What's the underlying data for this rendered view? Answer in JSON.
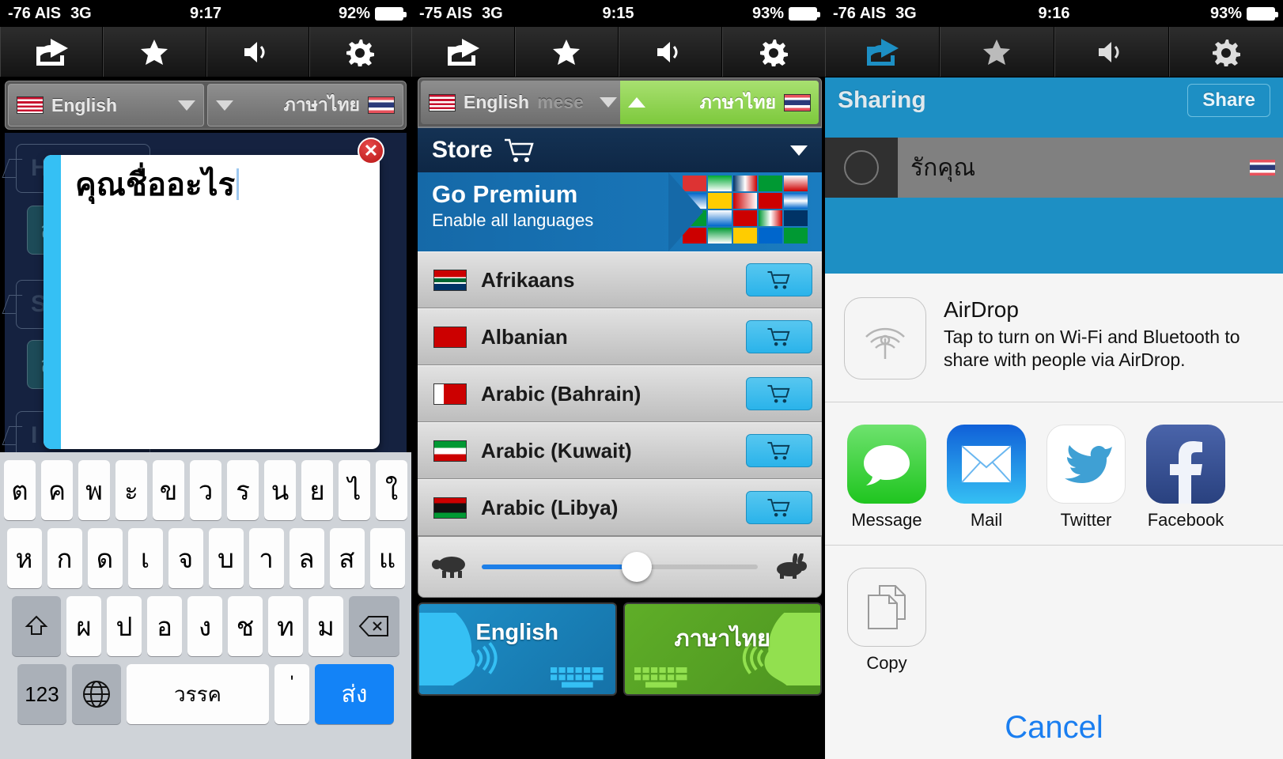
{
  "screens": [
    {
      "status": {
        "carrier": "-76 AIS",
        "network": "3G",
        "time": "9:17",
        "battery": "92%"
      },
      "toolbar": [
        "share-icon",
        "star-icon",
        "speaker-icon",
        "gear-icon"
      ],
      "lang_bar": {
        "source": "English",
        "target": "ภาษาไทย",
        "source_flag": "us",
        "target_flag": "th"
      },
      "text_box": {
        "value": "คุณชื่ออะไร"
      },
      "close_label": "✕",
      "chat_bubbles": [
        {
          "text": "Hello",
          "side": "left"
        },
        {
          "text": "สวัสดี",
          "side": "right"
        },
        {
          "text": "S",
          "side": "left"
        },
        {
          "text": "ส",
          "side": "right"
        },
        {
          "text": "I",
          "side": "left"
        }
      ],
      "keyboard": {
        "row1": [
          "ต",
          "ค",
          "พ",
          "ะ",
          "ข",
          "ว",
          "ร",
          "น",
          "ย",
          "ไ",
          "ใ"
        ],
        "row2": [
          "ห",
          "ก",
          "ด",
          "เ",
          "จ",
          "บ",
          "า",
          "ล",
          "ส",
          "แ"
        ],
        "row3": [
          "ผ",
          "ป",
          "อ",
          "ง",
          "ช",
          "ท",
          "ม"
        ],
        "shift": "shift-icon",
        "backspace": "backspace-icon",
        "numbers": "123",
        "globe": "globe-icon",
        "space": "วรรค",
        "apostrophe": "'",
        "send": "ส่ง"
      }
    },
    {
      "status": {
        "carrier": "-75 AIS",
        "network": "3G",
        "time": "9:15",
        "battery": "93%"
      },
      "toolbar": [
        "share-icon",
        "star-icon",
        "speaker-icon",
        "gear-icon"
      ],
      "lang_bar": {
        "source": "English",
        "source_ghost": "mese",
        "target": "ภาษาไทย",
        "source_flag": "us",
        "target_flag": "th"
      },
      "store": {
        "title": "Store",
        "cart": "cart-icon"
      },
      "premium": {
        "title": "Go Premium",
        "subtitle": "Enable all languages"
      },
      "languages": [
        {
          "name": "Afrikaans",
          "flag": "za"
        },
        {
          "name": "Albanian",
          "flag": "al"
        },
        {
          "name": "Arabic (Bahrain)",
          "flag": "bh"
        },
        {
          "name": "Arabic (Kuwait)",
          "flag": "kw"
        },
        {
          "name": "Arabic (Libya)",
          "flag": "ly"
        }
      ],
      "speed_slider": {
        "min_icon": "turtle-icon",
        "max_icon": "rabbit-icon",
        "value": 56
      },
      "speech_buttons": [
        {
          "label": "English",
          "color": "#1572a8"
        },
        {
          "label": "ภาษาไทย",
          "color": "#4d9420"
        }
      ]
    },
    {
      "status": {
        "carrier": "-76 AIS",
        "network": "3G",
        "time": "9:16",
        "battery": "93%"
      },
      "toolbar": [
        "share-icon",
        "star-icon",
        "speaker-icon",
        "gear-icon"
      ],
      "header": {
        "title": "Sharing",
        "share_button": "Share"
      },
      "selected_row": {
        "text": "รักคุณ",
        "flag": "th"
      },
      "airdrop": {
        "title": "AirDrop",
        "description": "Tap to turn on Wi-Fi and Bluetooth to share with people via AirDrop."
      },
      "apps": [
        {
          "label": "Message",
          "icon": "message-icon"
        },
        {
          "label": "Mail",
          "icon": "mail-icon"
        },
        {
          "label": "Twitter",
          "icon": "twitter-icon"
        },
        {
          "label": "Facebook",
          "icon": "facebook-icon"
        }
      ],
      "actions": [
        {
          "label": "Copy",
          "icon": "copy-icon"
        }
      ],
      "cancel": "Cancel"
    }
  ],
  "colors": {
    "accent_blue": "#1d8fc4",
    "cancel_blue": "#1a7ef0",
    "green": "#7dc93c",
    "store_dark": "#0e2745"
  }
}
